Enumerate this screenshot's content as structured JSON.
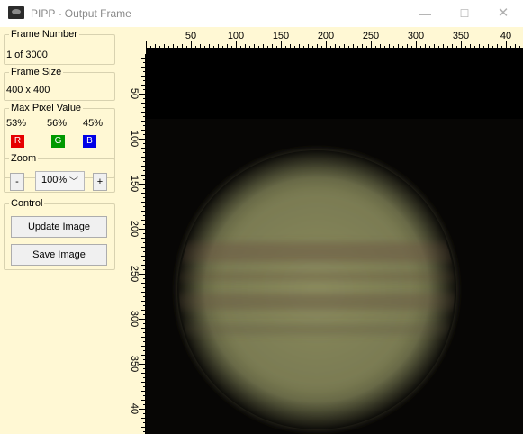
{
  "window": {
    "title": "PIPP - Output Frame",
    "minimize_glyph": "—",
    "maximize_glyph": "☐",
    "close_glyph": "✕"
  },
  "frame_number": {
    "legend": "Frame Number",
    "value": "1 of 3000"
  },
  "frame_size": {
    "legend": "Frame Size",
    "value": "400 x 400"
  },
  "max_pixel": {
    "legend": "Max Pixel Value",
    "channels": [
      {
        "label": "R",
        "value": "53%",
        "color": "#e60000"
      },
      {
        "label": "G",
        "value": "56%",
        "color": "#009900"
      },
      {
        "label": "B",
        "value": "45%",
        "color": "#0000e6"
      }
    ]
  },
  "zoom": {
    "legend": "Zoom",
    "minus": "-",
    "plus": "+",
    "value": "100%"
  },
  "control": {
    "legend": "Control",
    "update_label": "Update Image",
    "save_label": "Save Image"
  },
  "rulers": {
    "horizontal": [
      "50",
      "100",
      "150",
      "200",
      "250",
      "300",
      "350",
      "40"
    ],
    "vertical": [
      "50",
      "100",
      "150",
      "200",
      "250",
      "300",
      "350",
      "40"
    ]
  },
  "image": {
    "subject": "planet",
    "background_color": "#070605"
  }
}
